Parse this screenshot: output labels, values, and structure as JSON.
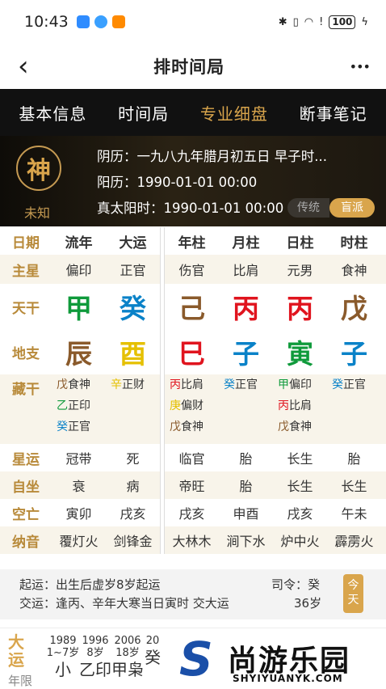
{
  "status": {
    "time": "10:43",
    "battery": "100"
  },
  "navbar": {
    "back_icon": "‹",
    "title": "排时间局",
    "more_icon": "•••"
  },
  "tabs": [
    "基本信息",
    "时间局",
    "专业细盘",
    "断事笔记"
  ],
  "profile": {
    "avatar_char": "神",
    "gender": "未知",
    "lunar": "阴历：一九八九年腊月初五日 早子时...",
    "solar": "阳历：1990-01-01 00:00",
    "true_solar": "真太阳时：1990-01-01 00:00",
    "btn_trad": "传统",
    "btn_blind": "盲派"
  },
  "grid": {
    "headers": [
      "日期",
      "流年",
      "大运",
      "年柱",
      "月柱",
      "日柱",
      "时柱"
    ],
    "zhuxing": {
      "label": "主星",
      "values": [
        "偏印",
        "正官",
        "伤官",
        "比肩",
        "元男",
        "食神"
      ]
    },
    "tiangan": {
      "label": "天干",
      "values": [
        "甲",
        "癸",
        "己",
        "丙",
        "丙",
        "戊"
      ]
    },
    "dizhi": {
      "label": "地支",
      "values": [
        "辰",
        "酉",
        "巳",
        "子",
        "寅",
        "子"
      ]
    },
    "canggan": {
      "label": "藏干",
      "cols": [
        [
          "戊食神",
          "乙正印",
          "癸正官"
        ],
        [
          "辛正财"
        ],
        [
          "丙比肩",
          "庚偏财",
          "戊食神"
        ],
        [
          "癸正官"
        ],
        [
          "甲偏印",
          "丙比肩",
          "戊食神"
        ],
        [
          "癸正官"
        ]
      ]
    },
    "xingyun": {
      "label": "星运",
      "values": [
        "冠带",
        "死",
        "临官",
        "胎",
        "长生",
        "胎"
      ]
    },
    "zizuo": {
      "label": "自坐",
      "values": [
        "衰",
        "病",
        "帝旺",
        "胎",
        "长生",
        "长生"
      ]
    },
    "kongwang": {
      "label": "空亡",
      "values": [
        "寅卯",
        "戌亥",
        "戌亥",
        "申酉",
        "戌亥",
        "午未"
      ]
    },
    "nayin": {
      "label": "纳音",
      "values": [
        "覆灯火",
        "剑锋金",
        "大林木",
        "涧下水",
        "炉中火",
        "霹雳火"
      ]
    }
  },
  "info": {
    "qiyun": "起运：出生后虚岁8岁起运",
    "siling": "司令：癸",
    "jiaoyun": "交运：逢丙、辛年大寒当日寅时 交大运",
    "age": "36岁",
    "today": "今天"
  },
  "dayun": {
    "label": "大运",
    "label2": "年限",
    "cols": [
      {
        "year": "1989",
        "age": "1~7岁",
        "char": "小"
      },
      {
        "year": "1996",
        "age": "8岁",
        "char": "乙印"
      },
      {
        "year": "2006",
        "age": "18岁",
        "char": "甲枭"
      },
      {
        "year": "20",
        "age": "",
        "char": "癸"
      }
    ]
  },
  "logo": {
    "name": "尚游乐园",
    "url": "SHYIYUANYK.COM"
  },
  "colors": {
    "gold": "#d9a54c",
    "wood": "#0f9a3b",
    "water": "#0a82c8",
    "fire": "#e0141e",
    "earth": "#8a5a2b",
    "metal": "#e5c000"
  }
}
